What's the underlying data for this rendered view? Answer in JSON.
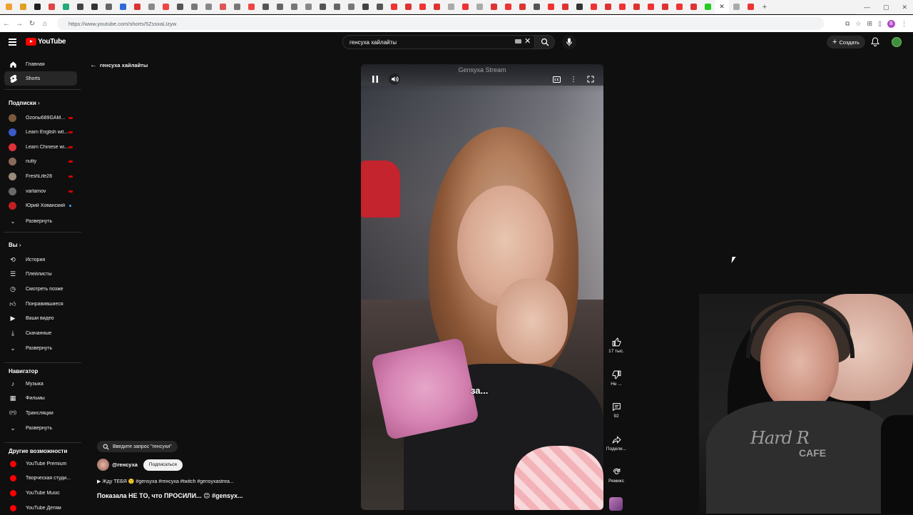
{
  "browser": {
    "url": "https://www.youtube.com/shorts/5ZssxaLIzyw",
    "tab_favicon_colors": [
      "#f0a030",
      "#e0a020",
      "#222",
      "#d44",
      "#2a7",
      "#444",
      "#333",
      "#666",
      "#2f6bd8",
      "#d33",
      "#888",
      "#e44",
      "#555",
      "#777",
      "#888",
      "#d55",
      "#777",
      "#e44",
      "#555",
      "#666",
      "#777",
      "#888",
      "#555",
      "#666",
      "#777",
      "#444",
      "#555",
      "#e33",
      "#d33",
      "#e33",
      "#d33",
      "#aaa",
      "#e33",
      "#aaa",
      "#d33",
      "#e33",
      "#d33",
      "#555",
      "#e33",
      "#d33",
      "#333",
      "#e33",
      "#d33",
      "#e33",
      "#d33",
      "#e33",
      "#d33",
      "#e33",
      "#d33",
      "#2c2",
      "#aaa",
      "#e33"
    ]
  },
  "masthead": {
    "logo_text": "YouTube",
    "search_value": "генсуха хайлайты",
    "create_label": "Создать"
  },
  "sidebar": {
    "main": [
      {
        "label": "Главная",
        "icon": "home-icon"
      },
      {
        "label": "Shorts",
        "icon": "shorts-icon"
      }
    ],
    "subscriptions_title": "Подписки",
    "subscriptions": [
      {
        "label": "Ozonы689GAM...",
        "color": "#7a5a3a"
      },
      {
        "label": "Learn English wit...",
        "color": "#3a5ac8"
      },
      {
        "label": "Learn Chinese wi...",
        "color": "#e0303a"
      },
      {
        "label": "nutty",
        "color": "#8a6a5a"
      },
      {
        "label": "FreshLife28",
        "color": "#9a8a7a"
      },
      {
        "label": "varlamov",
        "color": "#6a6a6a"
      },
      {
        "label": "Юрий Хованский",
        "color": "#c02020"
      }
    ],
    "expand_label": "Развернуть",
    "you_title": "Вы",
    "you_items": [
      {
        "label": "История",
        "icon": "history-icon"
      },
      {
        "label": "Плейлисты",
        "icon": "playlists-icon"
      },
      {
        "label": "Смотреть позже",
        "icon": "watch-later-icon"
      },
      {
        "label": "Понравившиеся",
        "icon": "liked-icon"
      },
      {
        "label": "Ваши видео",
        "icon": "your-videos-icon"
      },
      {
        "label": "Скачанные",
        "icon": "downloads-icon"
      },
      {
        "label": "Развернуть",
        "icon": "chevron-down-icon"
      }
    ],
    "navigator_title": "Навигатор",
    "navigator_items": [
      {
        "label": "Музыка",
        "icon": "music-icon"
      },
      {
        "label": "Фильмы",
        "icon": "movies-icon"
      },
      {
        "label": "Трансляции",
        "icon": "live-icon"
      },
      {
        "label": "Развернуть",
        "icon": "chevron-down-icon"
      }
    ],
    "other_title": "Другие возможности",
    "other_items": [
      {
        "label": "YouTube Premium"
      },
      {
        "label": "Творческая студи..."
      },
      {
        "label": "YouTube Music"
      },
      {
        "label": "YouTube Детям"
      }
    ]
  },
  "short": {
    "back_label": "генсуха хайлайты",
    "stream_watermark": "Gensyxa Stream",
    "caption": "за...",
    "search_chip": "Введите запрос \"генсухи\"",
    "channel": "@генсуха",
    "subscribe_label": "Подписаться",
    "description": "▶ Жду ТЕБЯ 🙂 #gensyxa #генсуха #twitch #gensyxastrea...",
    "title": "Показала НЕ ТО, что ПРОСИЛИ... 😊 #gensyx..."
  },
  "actions": {
    "like_count": "17 тыс.",
    "dislike_label": "Не ...",
    "comments_count": "92",
    "share_label": "Подели...",
    "remix_label": "Ремикс"
  },
  "webcam": {
    "shirt_logo": "Hard R",
    "shirt_sub": "CAFE"
  }
}
